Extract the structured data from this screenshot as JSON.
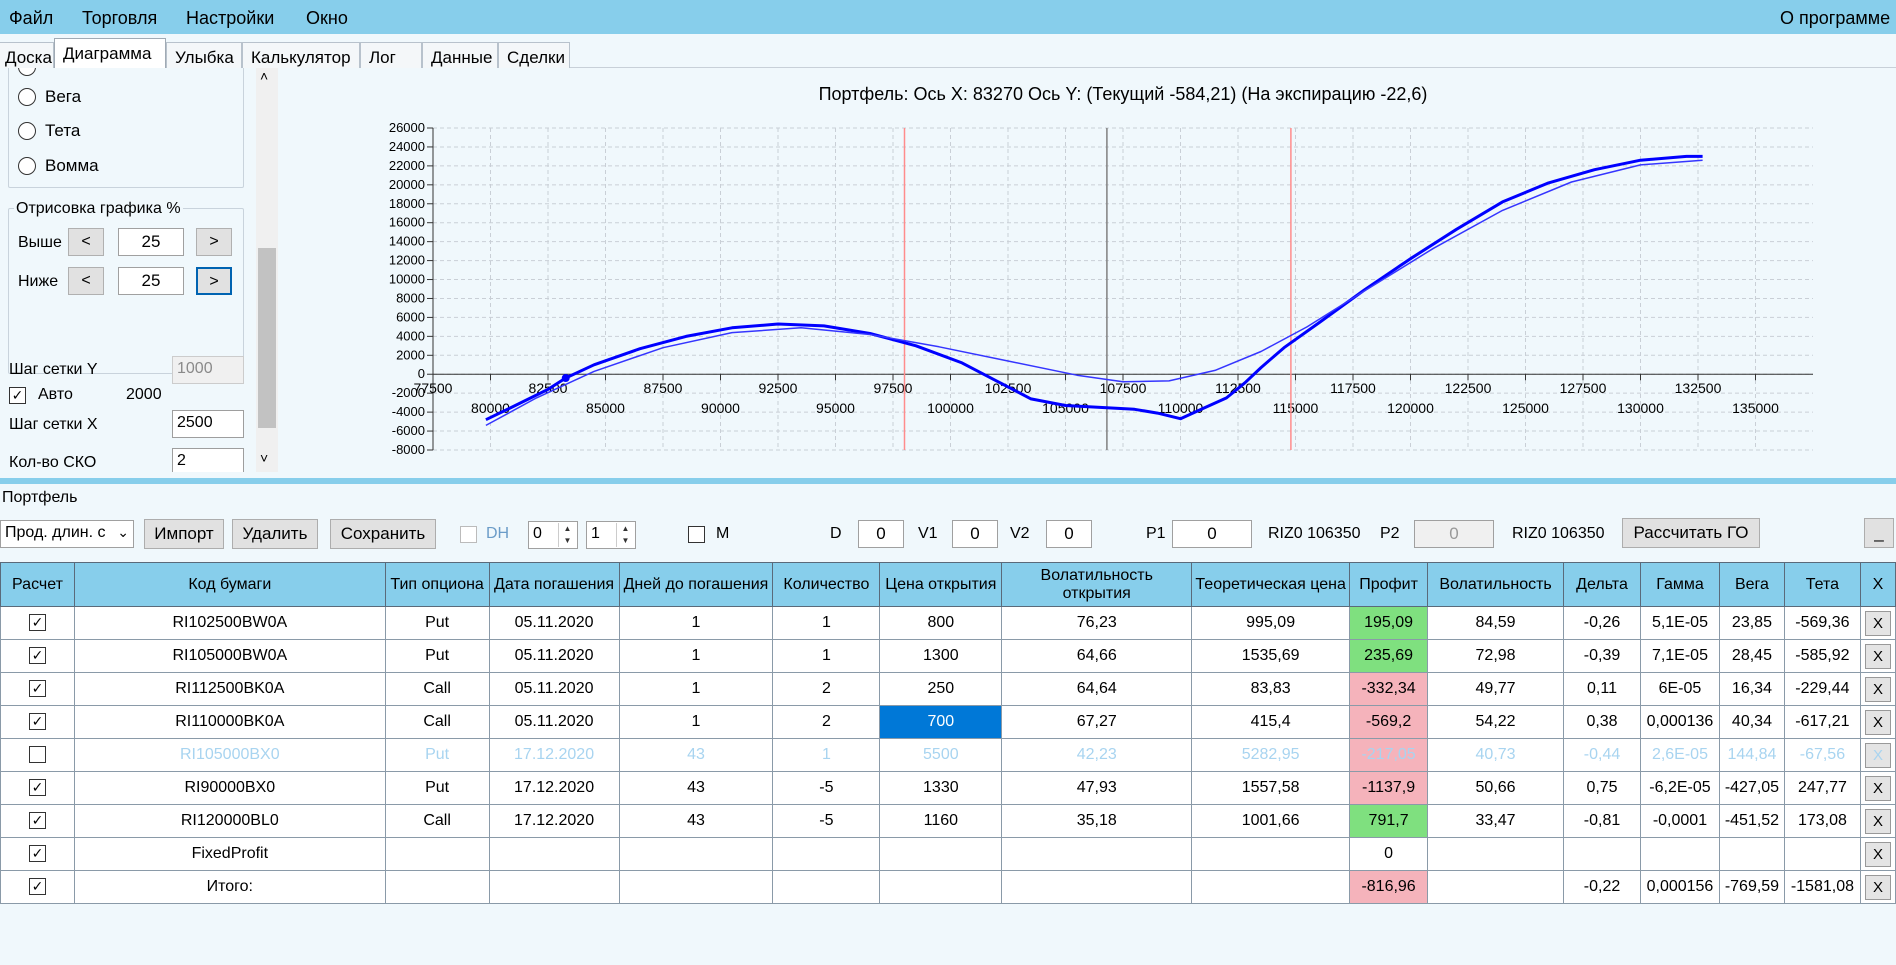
{
  "menu": {
    "file": "Файл",
    "trading": "Торговля",
    "settings": "Настройки",
    "window": "Окно",
    "about": "О программе"
  },
  "tabs": [
    "Доска",
    "Диаграмма",
    "Улыбка",
    "Калькулятор",
    "Лог",
    "Данные",
    "Сделки"
  ],
  "left": {
    "radios": [
      "Вега",
      "Тета",
      "Вомма"
    ],
    "draw_group_title": "Отрисовка графика %",
    "above_label": "Выше",
    "below_label": "Ниже",
    "prev": "<",
    "next": ">",
    "above_value": "25",
    "below_value": "25",
    "grid_y_label": "Шаг сетки Y",
    "grid_y_value": "1000",
    "auto_label": "Авто",
    "auto_value": "2000",
    "grid_x_label": "Шаг сетки X",
    "grid_x_value": "2500",
    "sko_label": "Кол-во СКО",
    "sko_value": "2"
  },
  "chart_data": {
    "type": "line",
    "title": "Портфель:  Ось X:  83270 Ось Y:   (Текущий -584,21)  (На экспирацию -22,6)",
    "xlim": [
      77500,
      137500
    ],
    "ylim": [
      -8000,
      26000
    ],
    "x_ticks_top": [
      77500,
      82500,
      87500,
      92500,
      97500,
      102500,
      107500,
      112500,
      117500,
      122500,
      127500,
      132500
    ],
    "x_ticks_bottom": [
      80000,
      85000,
      90000,
      95000,
      100000,
      105000,
      110000,
      115000,
      120000,
      125000,
      130000,
      135000
    ],
    "y_ticks": [
      26000,
      24000,
      22000,
      20000,
      18000,
      16000,
      14000,
      12000,
      10000,
      8000,
      6000,
      4000,
      2000,
      0,
      -2000,
      -4000,
      -6000,
      -8000
    ],
    "vlines": [
      {
        "x": 98000,
        "color": "#ff8c8c"
      },
      {
        "x": 106800,
        "color": "#808080"
      },
      {
        "x": 114800,
        "color": "#ff8c8c"
      }
    ],
    "series": [
      {
        "color": "#0000ff",
        "width": 3,
        "x": [
          79800,
          81000,
          82500,
          83270,
          84500,
          86500,
          88500,
          90500,
          92500,
          94500,
          96500,
          98500,
          100500,
          102000,
          103500,
          105000,
          106500,
          108000,
          109000,
          110000,
          111000,
          112000,
          112800,
          113500,
          114500,
          116000,
          118000,
          120000,
          122000,
          124000,
          126000,
          128000,
          130000,
          132000,
          132700
        ],
        "y": [
          -4800,
          -3400,
          -1600,
          -400,
          1000,
          2700,
          4000,
          4900,
          5300,
          5100,
          4300,
          3000,
          1200,
          -700,
          -2600,
          -3300,
          -3500,
          -3700,
          -4100,
          -4700,
          -3600,
          -2500,
          -900,
          700,
          2800,
          5400,
          8900,
          12200,
          15300,
          18200,
          20200,
          21600,
          22600,
          23000,
          23000
        ]
      },
      {
        "color": "#3535ff",
        "width": 1.5,
        "x": [
          79800,
          82000,
          84500,
          87500,
          90500,
          93500,
          96500,
          99500,
          102500,
          105500,
          107500,
          109500,
          111500,
          113500,
          115500,
          118000,
          121000,
          124000,
          127000,
          130000,
          132700
        ],
        "y": [
          -5400,
          -2500,
          300,
          2800,
          4400,
          4900,
          4200,
          2900,
          1400,
          -100,
          -800,
          -700,
          400,
          2400,
          5000,
          8800,
          13300,
          17300,
          20300,
          22100,
          22600
        ]
      }
    ]
  },
  "portfolio": {
    "label": "Портфель",
    "strategy": "Прод. длин. с",
    "import": "Импорт",
    "delete": "Удалить",
    "save": "Сохранить",
    "dh": "DH",
    "spin1": "0",
    "spin2": "1",
    "m": "M",
    "d_label": "D",
    "d_value": "0",
    "v1_label": "V1",
    "v1_value": "0",
    "v2_label": "V2",
    "v2_value": "0",
    "p1_label": "P1",
    "p1_value": "0",
    "p1_info": "RIZ0 106350",
    "p2_label": "P2",
    "p2_value": "0",
    "p2_info": "RIZ0 106350",
    "calc_go": "Рассчитать ГО",
    "minimize": "_"
  },
  "table": {
    "headers": [
      "Расчет",
      "Код бумаги",
      "Тип опциона",
      "Дата погашения",
      "Дней до погашения",
      "Количество",
      "Цена открытия",
      "Волатильность открытия",
      "Теоретическая цена",
      "Профит",
      "Волатильность",
      "Дельта",
      "Гамма",
      "Вега",
      "Тета",
      "X"
    ],
    "rows": [
      {
        "checked": true,
        "dim": false,
        "profit": "green",
        "selcol": -1,
        "cells": [
          "RI102500BW0A",
          "Put",
          "05.11.2020",
          "1",
          "1",
          "800",
          "76,23",
          "995,09",
          "195,09",
          "84,59",
          "-0,26",
          "5,1E-05",
          "23,85",
          "-569,36"
        ]
      },
      {
        "checked": true,
        "dim": false,
        "profit": "green",
        "selcol": -1,
        "cells": [
          "RI105000BW0A",
          "Put",
          "05.11.2020",
          "1",
          "1",
          "1300",
          "64,66",
          "1535,69",
          "235,69",
          "72,98",
          "-0,39",
          "7,1E-05",
          "28,45",
          "-585,92"
        ]
      },
      {
        "checked": true,
        "dim": false,
        "profit": "red",
        "selcol": -1,
        "cells": [
          "RI112500BK0A",
          "Call",
          "05.11.2020",
          "1",
          "2",
          "250",
          "64,64",
          "83,83",
          "-332,34",
          "49,77",
          "0,11",
          "6E-05",
          "16,34",
          "-229,44"
        ]
      },
      {
        "checked": true,
        "dim": false,
        "profit": "red",
        "selcol": 5,
        "cells": [
          "RI110000BK0A",
          "Call",
          "05.11.2020",
          "1",
          "2",
          "700",
          "67,27",
          "415,4",
          "-569,2",
          "54,22",
          "0,38",
          "0,000136",
          "40,34",
          "-617,21"
        ]
      },
      {
        "checked": false,
        "dim": true,
        "profit": "red",
        "selcol": -1,
        "cells": [
          "RI105000BX0",
          "Put",
          "17.12.2020",
          "43",
          "1",
          "5500",
          "42,23",
          "5282,95",
          "-217,05",
          "40,73",
          "-0,44",
          "2,6E-05",
          "144,84",
          "-67,56"
        ]
      },
      {
        "checked": true,
        "dim": false,
        "profit": "red",
        "selcol": -1,
        "cells": [
          "RI90000BX0",
          "Put",
          "17.12.2020",
          "43",
          "-5",
          "1330",
          "47,93",
          "1557,58",
          "-1137,9",
          "50,66",
          "0,75",
          "-6,2E-05",
          "-427,05",
          "247,77"
        ]
      },
      {
        "checked": true,
        "dim": false,
        "profit": "green",
        "selcol": -1,
        "cells": [
          "RI120000BL0",
          "Call",
          "17.12.2020",
          "43",
          "-5",
          "1160",
          "35,18",
          "1001,66",
          "791,7",
          "33,47",
          "-0,81",
          "-0,0001",
          "-451,52",
          "173,08"
        ]
      },
      {
        "checked": true,
        "dim": false,
        "profit": "none",
        "selcol": -1,
        "cells": [
          "FixedProfit",
          "",
          "",
          "",
          "",
          "",
          "",
          "",
          "0",
          "",
          "",
          "",
          "",
          ""
        ]
      },
      {
        "checked": true,
        "dim": false,
        "profit": "red",
        "selcol": -1,
        "cells": [
          "Итого:",
          "",
          "",
          "",
          "",
          "",
          "",
          "",
          "-816,96",
          "",
          "-0,22",
          "0,000156",
          "-769,59",
          "-1581,08"
        ]
      }
    ],
    "x_label": "X",
    "check_mark": "✓"
  }
}
